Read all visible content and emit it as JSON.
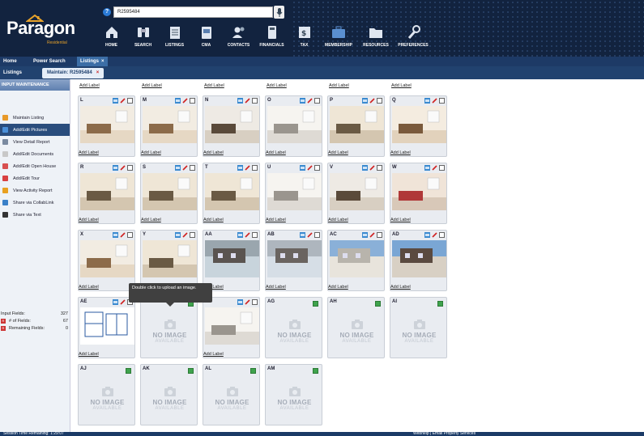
{
  "header": {
    "logo": "Paragon",
    "logo_sub": "Residential",
    "search_value": "R2595484",
    "nav": [
      {
        "label": "HOME",
        "icon": "home-icon"
      },
      {
        "label": "SEARCH",
        "icon": "binoculars-icon"
      },
      {
        "label": "LISTINGS",
        "icon": "listings-icon"
      },
      {
        "label": "CMA",
        "icon": "cma-icon"
      },
      {
        "label": "CONTACTS",
        "icon": "contacts-icon"
      },
      {
        "label": "FINANCIALS",
        "icon": "calculator-icon"
      },
      {
        "label": "TAX",
        "icon": "tax-icon"
      },
      {
        "label": "MEMBERSHIP",
        "icon": "briefcase-icon"
      },
      {
        "label": "RESOURCES",
        "icon": "folder-icon"
      },
      {
        "label": "PREFERENCES",
        "icon": "wrench-icon"
      }
    ]
  },
  "tabs": {
    "home": "Home",
    "power_search": "Power Search",
    "listings": "Listings",
    "close": "×"
  },
  "subtabs": {
    "listings": "Listings",
    "maintain": "Maintain: R2595484",
    "close": "×"
  },
  "sidebar": {
    "heading": "INPUT MAINTENANCE",
    "items": [
      {
        "label": "Maintain Listing",
        "color": "#e89a2a"
      },
      {
        "label": "Add/Edit Pictures",
        "color": "#4a8fd8"
      },
      {
        "label": "View Detail Report",
        "color": "#7a8aa0"
      },
      {
        "label": "Add/Edit Documents",
        "color": "#c8c8c8"
      },
      {
        "label": "Add/Edit Open House",
        "color": "#d85050"
      },
      {
        "label": "Add/Edit Tour",
        "color": "#d84040"
      },
      {
        "label": "View Activity Report",
        "color": "#e8a020"
      },
      {
        "label": "Share via CollabLink",
        "color": "#3a80c8"
      },
      {
        "label": "Share via Text",
        "color": "#333333"
      }
    ],
    "fields": {
      "input_label": "Input Fields:",
      "input_value": "327",
      "num_label": "# of Fields:",
      "num_value": "67",
      "remaining_label": "Remaining Fields:",
      "remaining_value": "0"
    }
  },
  "content": {
    "add_label": "Add Label",
    "no_image_1": "NO IMAGE",
    "no_image_2": "AVAILABLE",
    "tooltip": "Double click to upload an image.",
    "cards": [
      {
        "id": "L",
        "photo": true,
        "scene": "kitchen"
      },
      {
        "id": "M",
        "photo": true,
        "scene": "kitchen"
      },
      {
        "id": "N",
        "photo": true,
        "scene": "hall"
      },
      {
        "id": "O",
        "photo": true,
        "scene": "bath"
      },
      {
        "id": "P",
        "photo": true,
        "scene": "bedroom"
      },
      {
        "id": "Q",
        "photo": true,
        "scene": "living"
      },
      {
        "id": "R",
        "photo": true,
        "scene": "bedroom"
      },
      {
        "id": "S",
        "photo": true,
        "scene": "bedroom"
      },
      {
        "id": "T",
        "photo": true,
        "scene": "bedroom"
      },
      {
        "id": "U",
        "photo": true,
        "scene": "bath"
      },
      {
        "id": "V",
        "photo": true,
        "scene": "hall"
      },
      {
        "id": "W",
        "photo": true,
        "scene": "bedroom-red"
      },
      {
        "id": "X",
        "photo": true,
        "scene": "kitchen"
      },
      {
        "id": "Y",
        "photo": true,
        "scene": "bedroom"
      },
      {
        "id": "AA",
        "photo": true,
        "scene": "patio"
      },
      {
        "id": "AB",
        "photo": true,
        "scene": "yard"
      },
      {
        "id": "AC",
        "photo": true,
        "scene": "driveway"
      },
      {
        "id": "AD",
        "photo": true,
        "scene": "exterior"
      },
      {
        "id": "AE",
        "photo": true,
        "scene": "floorplan"
      },
      {
        "id": "AF",
        "photo": false
      },
      {
        "id": "",
        "photo": true,
        "scene": "bath"
      },
      {
        "id": "AG",
        "photo": false
      },
      {
        "id": "AH",
        "photo": false
      },
      {
        "id": "AI",
        "photo": false
      },
      {
        "id": "AJ",
        "photo": false
      },
      {
        "id": "AK",
        "photo": false
      },
      {
        "id": "AL",
        "photo": false
      },
      {
        "id": "AM",
        "photo": false
      }
    ]
  },
  "status": {
    "left": "Session Time Remaining: 1:29:07",
    "right": "Webhelp  |  Email Property Services"
  }
}
